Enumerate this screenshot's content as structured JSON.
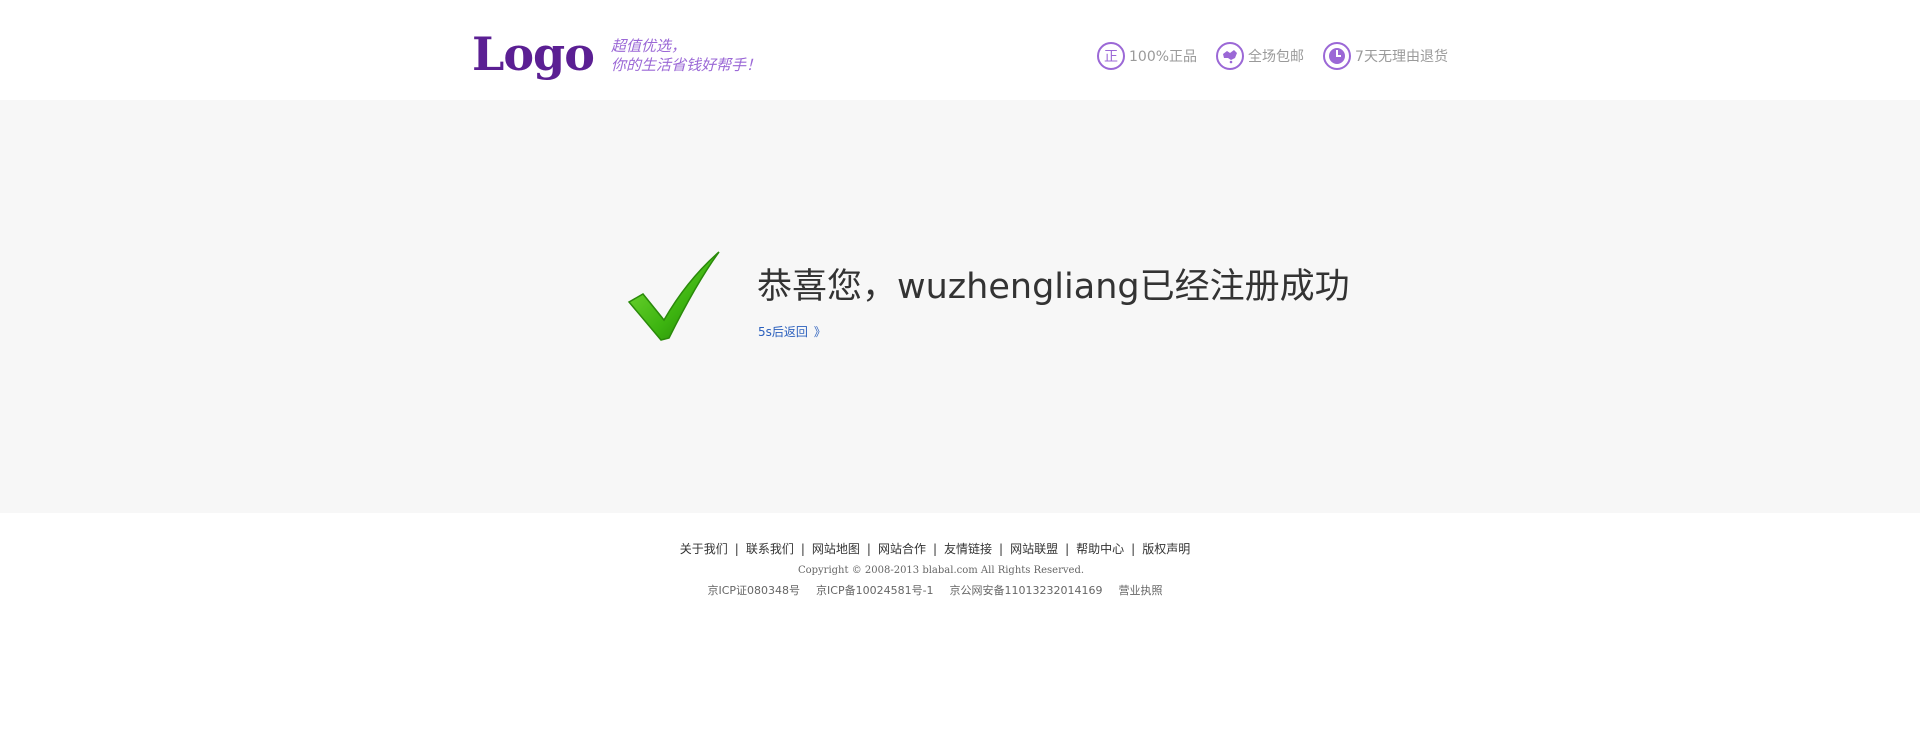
{
  "header": {
    "logo": "Logo",
    "slogan_line1": "超值优选，",
    "slogan_line2": "你的生活省钱好帮手！",
    "accent_color": "#5b1f93",
    "features": [
      {
        "icon": "genuine-icon",
        "label": "100%正品"
      },
      {
        "icon": "map-icon",
        "label": "全场包邮"
      },
      {
        "icon": "clock-icon",
        "label": "7天无理由退货"
      }
    ]
  },
  "main": {
    "icon": "checkmark-icon",
    "message": "恭喜您，wuzhengliang已经注册成功",
    "back_link": "5s后返回",
    "back_arrows": "》",
    "check_color": "#3cb310"
  },
  "footer": {
    "links": [
      "关于我们",
      "联系我们",
      "网站地图",
      "网站合作",
      "友情链接",
      "网站联盟",
      "帮助中心",
      "版权声明"
    ],
    "separator": "|",
    "copyright": "Copyright © 2008-2013 blabal.com All Rights Reserved.",
    "icp": [
      "京ICP证080348号",
      "京ICP备10024581号-1",
      "京公网安备11013232014169",
      "营业执照"
    ]
  }
}
